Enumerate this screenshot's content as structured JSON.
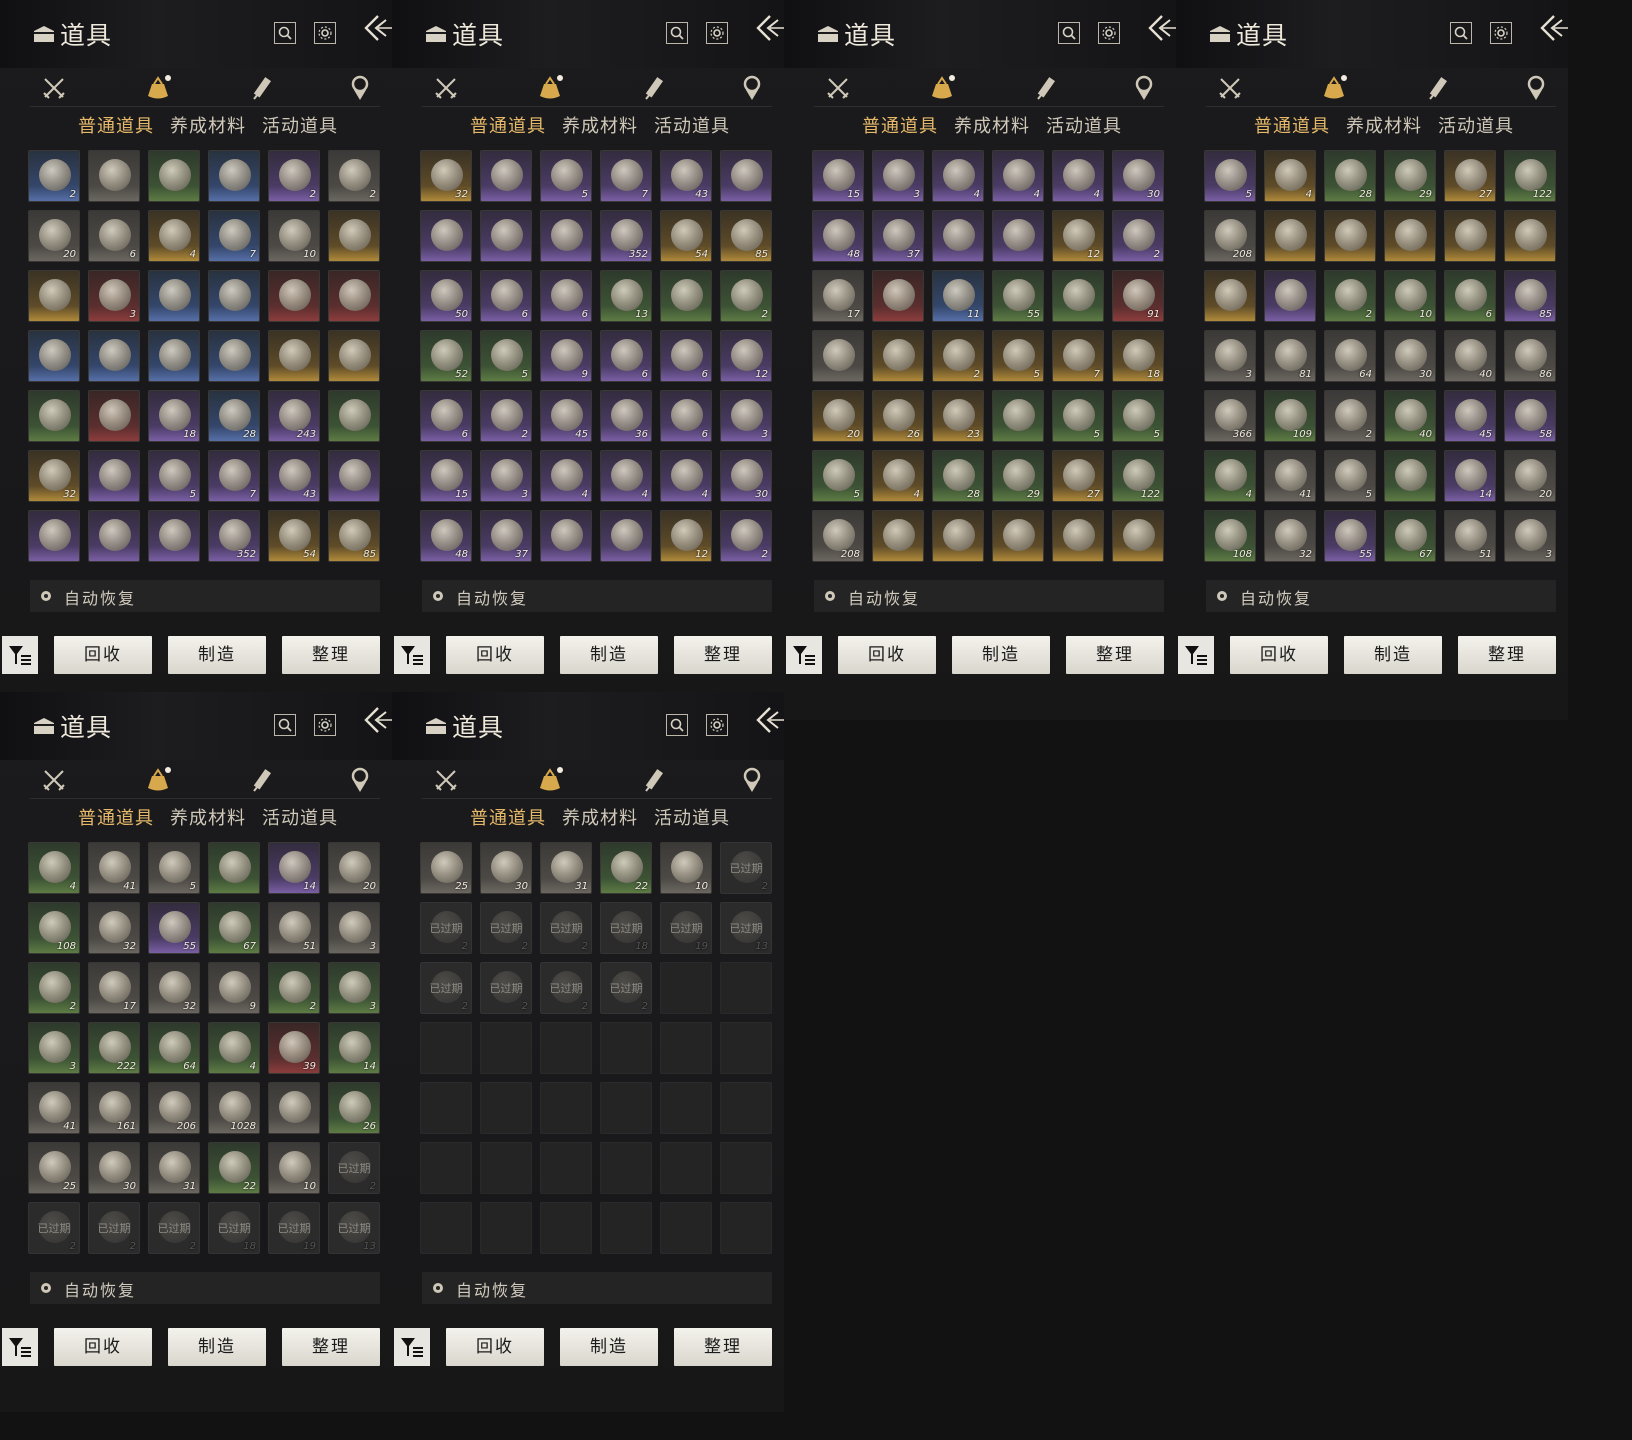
{
  "header": {
    "title": "道具"
  },
  "subtabs": [
    "普通道具",
    "养成材料",
    "活动道具"
  ],
  "auto_restore": "自动恢复",
  "actions": {
    "recycle": "回收",
    "craft": "制造",
    "sort": "整理"
  },
  "expired_label": "已过期",
  "colors": {
    "accent": "#e6b96a",
    "panel": "#1b1b1d"
  },
  "icons": {
    "category_tabs": [
      "crossed-swords-icon",
      "pouch-icon",
      "scroll-icon",
      "badge-icon"
    ],
    "header": [
      "chest-icon",
      "search-icon",
      "gear-icon",
      "back-arrow-icon"
    ]
  },
  "panels": [
    {
      "cells": [
        [
          "blue",
          "2"
        ],
        [
          "white",
          ""
        ],
        [
          "green",
          ""
        ],
        [
          "blue",
          ""
        ],
        [
          "purple",
          "2"
        ],
        [
          "white",
          "2"
        ],
        [
          "white",
          "20"
        ],
        [
          "white",
          "6"
        ],
        [
          "gold",
          "4"
        ],
        [
          "blue",
          "7"
        ],
        [
          "white",
          "10"
        ],
        [
          "gold",
          ""
        ],
        [
          "gold",
          ""
        ],
        [
          "red",
          "3"
        ],
        [
          "blue",
          ""
        ],
        [
          "blue",
          ""
        ],
        [
          "red",
          ""
        ],
        [
          "red",
          ""
        ],
        [
          "blue",
          ""
        ],
        [
          "blue",
          ""
        ],
        [
          "blue",
          ""
        ],
        [
          "blue",
          ""
        ],
        [
          "gold",
          ""
        ],
        [
          "gold",
          ""
        ],
        [
          "green",
          ""
        ],
        [
          "red",
          ""
        ],
        [
          "purple",
          "18"
        ],
        [
          "blue",
          "28"
        ],
        [
          "purple",
          "243"
        ],
        [
          "green",
          ""
        ],
        [
          "gold",
          "32"
        ],
        [
          "purple",
          ""
        ],
        [
          "purple",
          "5"
        ],
        [
          "purple",
          "7"
        ],
        [
          "purple",
          "43"
        ],
        [
          "purple",
          ""
        ],
        [
          "purple",
          ""
        ],
        [
          "purple",
          ""
        ],
        [
          "purple",
          ""
        ],
        [
          "purple",
          "352"
        ],
        [
          "gold",
          "54"
        ],
        [
          "gold",
          "85"
        ]
      ]
    },
    {
      "cells": [
        [
          "gold",
          "32"
        ],
        [
          "purple",
          ""
        ],
        [
          "purple",
          "5"
        ],
        [
          "purple",
          "7"
        ],
        [
          "purple",
          "43"
        ],
        [
          "purple",
          ""
        ],
        [
          "purple",
          ""
        ],
        [
          "purple",
          ""
        ],
        [
          "purple",
          ""
        ],
        [
          "purple",
          "352"
        ],
        [
          "gold",
          "54"
        ],
        [
          "gold",
          "85"
        ],
        [
          "purple",
          "50"
        ],
        [
          "purple",
          "6"
        ],
        [
          "purple",
          "6"
        ],
        [
          "green",
          "13"
        ],
        [
          "green",
          ""
        ],
        [
          "green",
          "2"
        ],
        [
          "green",
          "52"
        ],
        [
          "green",
          "5"
        ],
        [
          "purple",
          "9"
        ],
        [
          "purple",
          "6"
        ],
        [
          "purple",
          "6"
        ],
        [
          "purple",
          "12"
        ],
        [
          "purple",
          "6"
        ],
        [
          "purple",
          "2"
        ],
        [
          "purple",
          "45"
        ],
        [
          "purple",
          "36"
        ],
        [
          "purple",
          "6"
        ],
        [
          "purple",
          "3"
        ],
        [
          "purple",
          "15"
        ],
        [
          "purple",
          "3"
        ],
        [
          "purple",
          "4"
        ],
        [
          "purple",
          "4"
        ],
        [
          "purple",
          "4"
        ],
        [
          "purple",
          "30"
        ],
        [
          "purple",
          "48"
        ],
        [
          "purple",
          "37"
        ],
        [
          "purple",
          ""
        ],
        [
          "purple",
          ""
        ],
        [
          "gold",
          "12"
        ],
        [
          "purple",
          "2"
        ]
      ]
    },
    {
      "cells": [
        [
          "purple",
          "15"
        ],
        [
          "purple",
          "3"
        ],
        [
          "purple",
          "4"
        ],
        [
          "purple",
          "4"
        ],
        [
          "purple",
          "4"
        ],
        [
          "purple",
          "30"
        ],
        [
          "purple",
          "48"
        ],
        [
          "purple",
          "37"
        ],
        [
          "purple",
          ""
        ],
        [
          "purple",
          ""
        ],
        [
          "gold",
          "12"
        ],
        [
          "purple",
          "2"
        ],
        [
          "white",
          "17"
        ],
        [
          "red",
          ""
        ],
        [
          "blue",
          "11"
        ],
        [
          "green",
          "55"
        ],
        [
          "green",
          ""
        ],
        [
          "red",
          "91"
        ],
        [
          "white",
          ""
        ],
        [
          "gold",
          ""
        ],
        [
          "gold",
          "2"
        ],
        [
          "gold",
          "5"
        ],
        [
          "gold",
          "7"
        ],
        [
          "gold",
          "18"
        ],
        [
          "gold",
          "20"
        ],
        [
          "gold",
          "26"
        ],
        [
          "gold",
          "23"
        ],
        [
          "green",
          ""
        ],
        [
          "green",
          "5"
        ],
        [
          "green",
          "5"
        ],
        [
          "green",
          "5"
        ],
        [
          "gold",
          "4"
        ],
        [
          "green",
          "28"
        ],
        [
          "green",
          "29"
        ],
        [
          "gold",
          "27"
        ],
        [
          "green",
          "122"
        ],
        [
          "white",
          "208"
        ],
        [
          "gold",
          ""
        ],
        [
          "gold",
          ""
        ],
        [
          "gold",
          ""
        ],
        [
          "gold",
          ""
        ],
        [
          "gold",
          ""
        ]
      ]
    },
    {
      "cells": [
        [
          "purple",
          "5"
        ],
        [
          "gold",
          "4"
        ],
        [
          "green",
          "28"
        ],
        [
          "green",
          "29"
        ],
        [
          "gold",
          "27"
        ],
        [
          "green",
          "122"
        ],
        [
          "white",
          "208"
        ],
        [
          "gold",
          ""
        ],
        [
          "gold",
          ""
        ],
        [
          "gold",
          ""
        ],
        [
          "gold",
          ""
        ],
        [
          "gold",
          ""
        ],
        [
          "gold",
          ""
        ],
        [
          "purple",
          ""
        ],
        [
          "green",
          "2"
        ],
        [
          "green",
          "10"
        ],
        [
          "green",
          "6"
        ],
        [
          "purple",
          "85"
        ],
        [
          "white",
          "3"
        ],
        [
          "white",
          "81"
        ],
        [
          "white",
          "64"
        ],
        [
          "white",
          "30"
        ],
        [
          "white",
          "40"
        ],
        [
          "white",
          "86"
        ],
        [
          "white",
          "366"
        ],
        [
          "green",
          "109"
        ],
        [
          "white",
          "2"
        ],
        [
          "green",
          "40"
        ],
        [
          "purple",
          "45"
        ],
        [
          "purple",
          "58"
        ],
        [
          "green",
          "4"
        ],
        [
          "white",
          "41"
        ],
        [
          "white",
          "5"
        ],
        [
          "green",
          ""
        ],
        [
          "purple",
          "14"
        ],
        [
          "white",
          "20"
        ],
        [
          "green",
          "108"
        ],
        [
          "white",
          "32"
        ],
        [
          "purple",
          "55"
        ],
        [
          "green",
          "67"
        ],
        [
          "white",
          "51"
        ],
        [
          "white",
          "3"
        ]
      ]
    },
    {
      "cells": [
        [
          "green",
          "4"
        ],
        [
          "white",
          "41"
        ],
        [
          "white",
          "5"
        ],
        [
          "green",
          ""
        ],
        [
          "purple",
          "14"
        ],
        [
          "white",
          "20"
        ],
        [
          "green",
          "108"
        ],
        [
          "white",
          "32"
        ],
        [
          "purple",
          "55"
        ],
        [
          "green",
          "67"
        ],
        [
          "white",
          "51"
        ],
        [
          "white",
          "3"
        ],
        [
          "green",
          "2"
        ],
        [
          "white",
          "17"
        ],
        [
          "white",
          "32"
        ],
        [
          "white",
          "9"
        ],
        [
          "green",
          "2"
        ],
        [
          "green",
          "3"
        ],
        [
          "green",
          "3"
        ],
        [
          "green",
          "222"
        ],
        [
          "green",
          "64"
        ],
        [
          "green",
          "4"
        ],
        [
          "red",
          "39"
        ],
        [
          "green",
          "14"
        ],
        [
          "white",
          "41"
        ],
        [
          "white",
          "161"
        ],
        [
          "white",
          "206"
        ],
        [
          "white",
          "1028"
        ],
        [
          "white",
          ""
        ],
        [
          "green",
          "26"
        ],
        [
          "white",
          "25"
        ],
        [
          "white",
          "30"
        ],
        [
          "white",
          "31"
        ],
        [
          "green",
          "22"
        ],
        [
          "white",
          "10"
        ],
        [
          "expired",
          "2"
        ],
        [
          "expired",
          "2"
        ],
        [
          "expired",
          "2"
        ],
        [
          "expired",
          "2"
        ],
        [
          "expired",
          "18"
        ],
        [
          "expired",
          "19"
        ],
        [
          "expired",
          "13"
        ]
      ]
    },
    {
      "cells": [
        [
          "white",
          "25"
        ],
        [
          "white",
          "30"
        ],
        [
          "white",
          "31"
        ],
        [
          "green",
          "22"
        ],
        [
          "white",
          "10"
        ],
        [
          "expired",
          "2"
        ],
        [
          "expired",
          "2"
        ],
        [
          "expired",
          "2"
        ],
        [
          "expired",
          "2"
        ],
        [
          "expired",
          "18"
        ],
        [
          "expired",
          "19"
        ],
        [
          "expired",
          "13"
        ],
        [
          "expired",
          "2"
        ],
        [
          "expired",
          "2"
        ],
        [
          "expired",
          "2"
        ],
        [
          "expired",
          "2"
        ],
        [
          "empty",
          ""
        ],
        [
          "empty",
          ""
        ],
        [
          "empty",
          ""
        ],
        [
          "empty",
          ""
        ],
        [
          "empty",
          ""
        ],
        [
          "empty",
          ""
        ],
        [
          "empty",
          ""
        ],
        [
          "empty",
          ""
        ],
        [
          "empty",
          ""
        ],
        [
          "empty",
          ""
        ],
        [
          "empty",
          ""
        ],
        [
          "empty",
          ""
        ],
        [
          "empty",
          ""
        ],
        [
          "empty",
          ""
        ],
        [
          "empty",
          ""
        ],
        [
          "empty",
          ""
        ],
        [
          "empty",
          ""
        ],
        [
          "empty",
          ""
        ],
        [
          "empty",
          ""
        ],
        [
          "empty",
          ""
        ],
        [
          "empty",
          ""
        ],
        [
          "empty",
          ""
        ],
        [
          "empty",
          ""
        ],
        [
          "empty",
          ""
        ],
        [
          "empty",
          ""
        ],
        [
          "empty",
          ""
        ]
      ]
    }
  ]
}
